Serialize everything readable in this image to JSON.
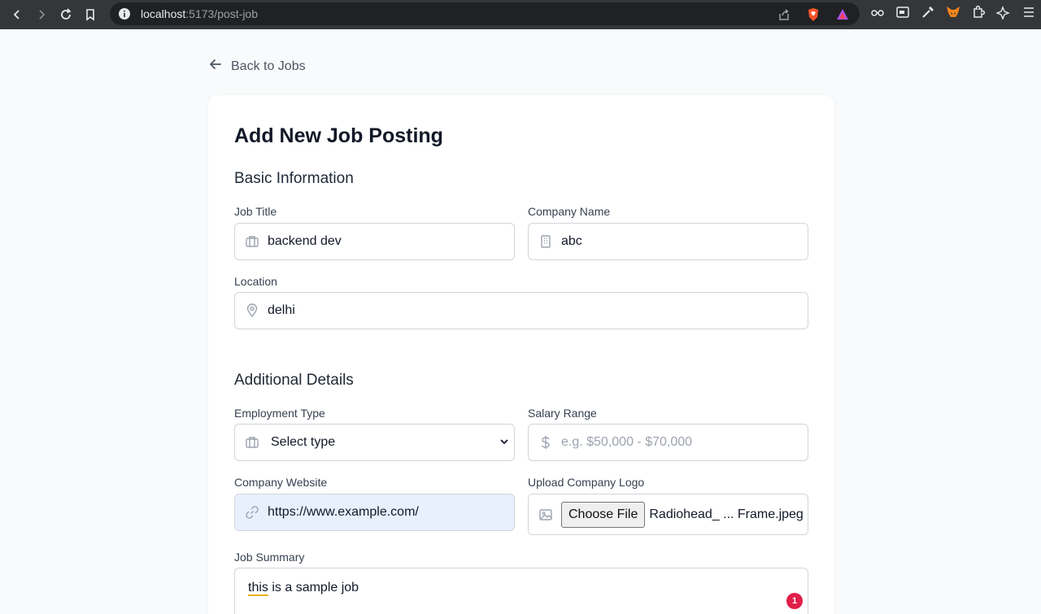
{
  "browser": {
    "url_host": "localhost",
    "url_path": ":5173/post-job"
  },
  "page": {
    "back_label": "Back to Jobs",
    "title": "Add New Job Posting"
  },
  "basic": {
    "section_title": "Basic Information",
    "job_title_label": "Job Title",
    "job_title_value": "backend dev",
    "company_label": "Company Name",
    "company_value": "abc",
    "location_label": "Location",
    "location_value": "delhi"
  },
  "additional": {
    "section_title": "Additional Details",
    "employment_label": "Employment Type",
    "employment_selected": "Select type",
    "salary_label": "Salary Range",
    "salary_placeholder": "e.g. $50,000 - $70,000",
    "website_label": "Company Website",
    "website_value": "https://www.example.com/",
    "logo_label": "Upload Company Logo",
    "logo_button": "Choose File",
    "logo_filename": "Radiohead_ ... Frame.jpeg"
  },
  "summary": {
    "label": "Job Summary",
    "text_word1": "this",
    "text_rest": " is a sample job",
    "badge_count": "1"
  },
  "colors": {
    "accent_autofill": "#e8f0fe",
    "badge": "#e11d48"
  }
}
